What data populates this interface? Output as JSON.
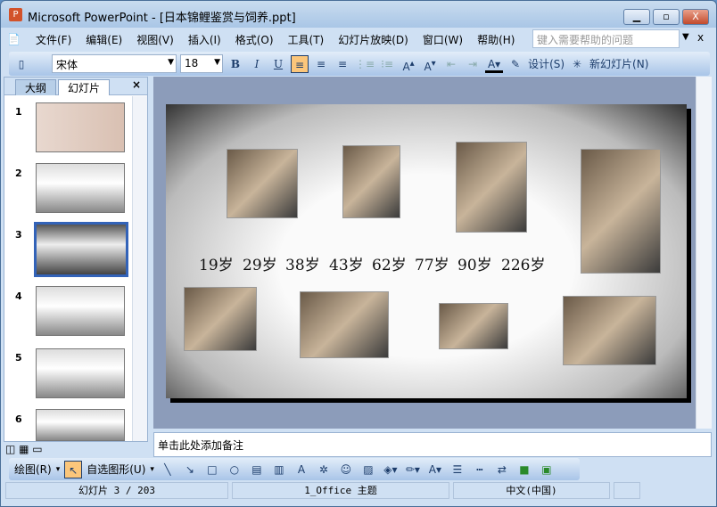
{
  "window": {
    "title": "Microsoft PowerPoint - [日本锦鲤鉴赏与饲养.ppt]",
    "min": "▁",
    "max": "▫",
    "close": "X"
  },
  "menu": [
    "文件(F)",
    "编辑(E)",
    "视图(V)",
    "插入(I)",
    "格式(O)",
    "工具(T)",
    "幻灯片放映(D)",
    "窗口(W)",
    "帮助(H)"
  ],
  "help_placeholder": "键入需要帮助的问题",
  "toolbar": {
    "font": "宋体",
    "size": "18",
    "bold": "B",
    "italic": "I",
    "underline": "U",
    "design": "设计(S)",
    "new_slide": "新幻灯片(N)"
  },
  "panel": {
    "tabs": [
      "大纲",
      "幻灯片"
    ],
    "close": "×",
    "slides": [
      "1",
      "2",
      "3",
      "4",
      "5",
      "6"
    ],
    "current": 3
  },
  "slide": {
    "ages": [
      "19岁",
      "29岁",
      "38岁",
      "43岁",
      "62岁",
      "77岁",
      "90岁",
      "226岁"
    ]
  },
  "notes_placeholder": "单击此处添加备注",
  "drawbar": {
    "draw": "绘图(R)",
    "autoshapes": "自选图形(U)"
  },
  "status": {
    "slide": "幻灯片 3 / 203",
    "theme": "1_Office 主题",
    "lang": "中文(中国)"
  }
}
